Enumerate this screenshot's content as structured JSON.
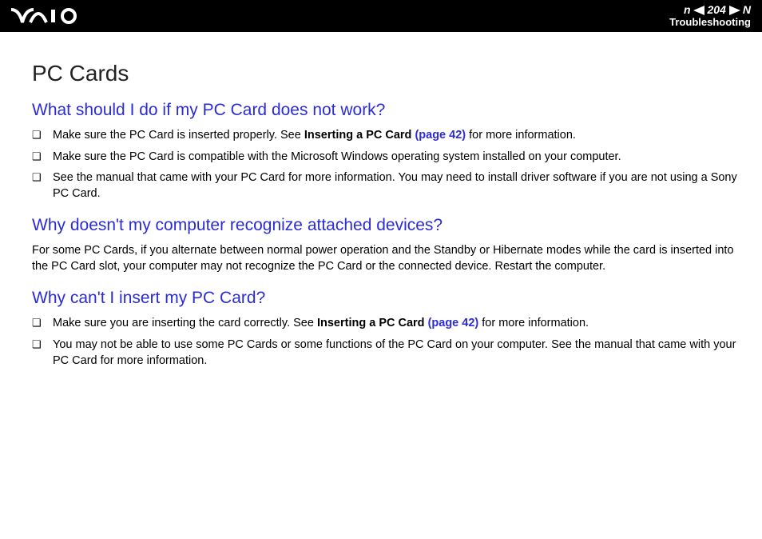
{
  "header": {
    "page_number": "204",
    "section": "Troubleshooting"
  },
  "title": "PC Cards",
  "q1": {
    "heading": "What should I do if my PC Card does not work?",
    "b1_a": "Make sure the PC Card is inserted properly. See ",
    "b1_bold": "Inserting a PC Card ",
    "b1_link": "(page 42)",
    "b1_c": " for more information.",
    "b2": "Make sure the PC Card is compatible with the Microsoft Windows operating system installed on your computer.",
    "b3": "See the manual that came with your PC Card for more information. You may need to install driver software if you are not using a Sony PC Card."
  },
  "q2": {
    "heading": "Why doesn't my computer recognize attached devices?",
    "para": "For some PC Cards, if you alternate between normal power operation and the Standby or Hibernate modes while the card is inserted into the PC Card slot, your computer may not recognize the PC Card or the connected device. Restart the computer."
  },
  "q3": {
    "heading": "Why can't I insert my PC Card?",
    "b1_a": "Make sure you are inserting the card correctly. See ",
    "b1_bold": "Inserting a PC Card ",
    "b1_link": "(page 42)",
    "b1_c": " for more information.",
    "b2": "You may not be able to use some PC Cards or some functions of the PC Card on your computer. See the manual that came with your PC Card for more information."
  }
}
